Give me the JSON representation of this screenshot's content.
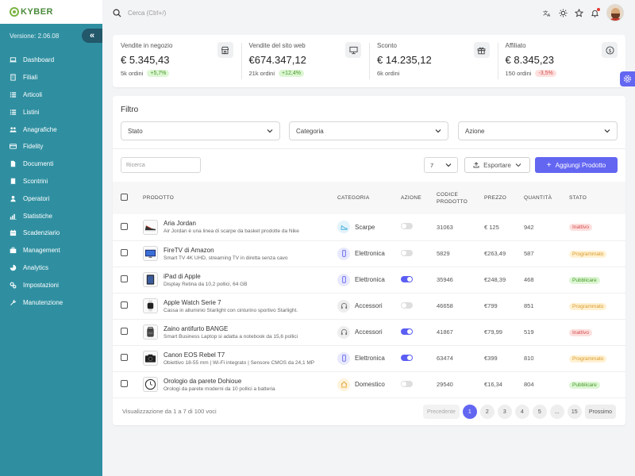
{
  "brand": {
    "logo_text": "KYBER",
    "version": "Versione: 2.06.08"
  },
  "sidebar": {
    "items": [
      {
        "label": "Dashboard",
        "icon": "laptop-icon"
      },
      {
        "label": "Filiali",
        "icon": "building-icon"
      },
      {
        "label": "Articoli",
        "icon": "list-icon"
      },
      {
        "label": "Listini",
        "icon": "list-icon"
      },
      {
        "label": "Anagrafiche",
        "icon": "users-icon"
      },
      {
        "label": "Fidelity",
        "icon": "card-icon"
      },
      {
        "label": "Documenti",
        "icon": "document-icon"
      },
      {
        "label": "Scontrini",
        "icon": "receipt-icon"
      },
      {
        "label": "Operatori",
        "icon": "user-icon"
      },
      {
        "label": "Statistiche",
        "icon": "chart-icon"
      },
      {
        "label": "Scadenziario",
        "icon": "calendar-icon"
      },
      {
        "label": "Management",
        "icon": "briefcase-icon"
      },
      {
        "label": "Analytics",
        "icon": "analytics-icon"
      },
      {
        "label": "Impostazioni",
        "icon": "cogs-icon"
      },
      {
        "label": "Manutenzione",
        "icon": "wrench-icon"
      }
    ]
  },
  "topbar": {
    "search_placeholder": "Cerca (Ctrl+/)"
  },
  "stats": [
    {
      "label": "Vendite in negozio",
      "value": "€ 5.345,43",
      "sub": "5k ordini",
      "delta": "+5,7%",
      "trend": "up",
      "icon": "shop-icon"
    },
    {
      "label": "Vendite del sito web",
      "value": "€674.347,12",
      "sub": "21k ordini",
      "delta": "+12,4%",
      "trend": "up",
      "icon": "monitor-icon"
    },
    {
      "label": "Sconto",
      "value": "€ 14.235,12",
      "sub": "6k ordini",
      "delta": "",
      "trend": "",
      "icon": "gift-icon"
    },
    {
      "label": "Affiliato",
      "value": "€ 8.345,23",
      "sub": "150 ordini",
      "delta": "-3,5%",
      "trend": "down",
      "icon": "dollar-icon"
    }
  ],
  "filters": {
    "title": "Filtro",
    "stato": "Stato",
    "categoria": "Categoria",
    "azione": "Azione"
  },
  "toolbar": {
    "search_placeholder": "Ricerca",
    "page_size": "7",
    "export_label": "Esportare",
    "add_label": "Aggiungi Prodotto"
  },
  "table": {
    "headers": {
      "prodotto": "PRODOTTO",
      "categoria": "CATEGORIA",
      "azione": "AZIONE",
      "codice1": "CODICE",
      "codice2": "PRODOTTO",
      "prezzo": "PREZZO",
      "quantita": "QUANTITÀ",
      "stato": "STATO"
    },
    "rows": [
      {
        "name": "Aria Jordan",
        "desc": "Air Jordan è una linea di scarpe da basket prodotte da Nike",
        "category": "Scarpe",
        "cat_icon": "shoe-icon",
        "active": false,
        "code": "31063",
        "price": "€ 125",
        "qty": "942",
        "status": "Inattivo",
        "status_type": "inattivo",
        "img_icon": "sneaker-icon"
      },
      {
        "name": "FireTV di Amazon",
        "desc": "Smart TV 4K UHD, streaming TV in diretta senza cavo",
        "category": "Elettronica",
        "cat_icon": "mobile-icon",
        "active": false,
        "code": "5829",
        "price": "€263,49",
        "qty": "587",
        "status": "Programmato",
        "status_type": "programmato",
        "img_icon": "tv-icon"
      },
      {
        "name": "iPad di Apple",
        "desc": "Display Retina da 10,2 pollici, 64 GB",
        "category": "Elettronica",
        "cat_icon": "mobile-icon",
        "active": true,
        "code": "35946",
        "price": "€248,39",
        "qty": "468",
        "status": "Pubblicare",
        "status_type": "pubblicare",
        "img_icon": "tablet-icon"
      },
      {
        "name": "Apple Watch Serie 7",
        "desc": "Cassa in alluminio Starlight con cinturino sportivo Starlight.",
        "category": "Accessori",
        "cat_icon": "headphones-icon",
        "active": false,
        "code": "46658",
        "price": "€799",
        "qty": "851",
        "status": "Programmato",
        "status_type": "programmato",
        "img_icon": "watch-icon"
      },
      {
        "name": "Zaino antifurto BANGE",
        "desc": "Smart Business Laptop si adatta a notebook da 15,6 pollici",
        "category": "Accessori",
        "cat_icon": "headphones-icon",
        "active": true,
        "code": "41867",
        "price": "€79,99",
        "qty": "519",
        "status": "Inattivo",
        "status_type": "inattivo",
        "img_icon": "backpack-icon"
      },
      {
        "name": "Canon EOS Rebel T7",
        "desc": "Obiettivo 18-55 mm | Wi-Fi integrato | Sensore CMOS da 24,1 MP",
        "category": "Elettronica",
        "cat_icon": "mobile-icon",
        "active": true,
        "code": "63474",
        "price": "€399",
        "qty": "810",
        "status": "Programmato",
        "status_type": "programmato",
        "img_icon": "camera-icon"
      },
      {
        "name": "Orologio da parete Dohioue",
        "desc": "Orologi da parete moderni da 10 pollici a batteria",
        "category": "Domestico",
        "cat_icon": "home-icon",
        "active": false,
        "code": "29540",
        "price": "€16,34",
        "qty": "804",
        "status": "Pubblicare",
        "status_type": "pubblicare",
        "img_icon": "clock-icon"
      }
    ]
  },
  "footer": {
    "info": "Visualizzazione da 1 a 7 di 100 voci",
    "prev": "Precedente",
    "pages": [
      "1",
      "2",
      "3",
      "4",
      "5",
      "...",
      "15"
    ],
    "next": "Prossimo"
  },
  "colors": {
    "sidebar": "#2f8fa1",
    "accent": "#6366f1"
  }
}
